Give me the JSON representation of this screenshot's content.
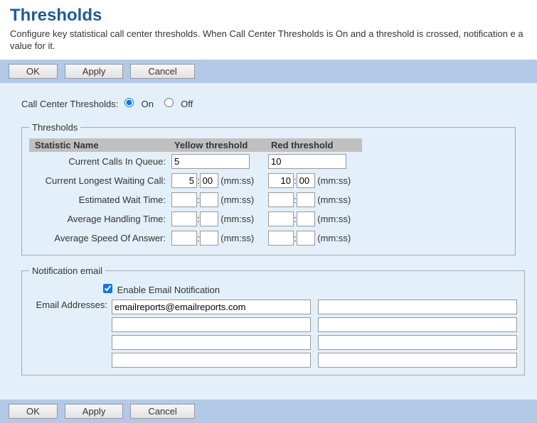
{
  "header": {
    "title": "Thresholds",
    "description": "Configure key statistical call center thresholds. When Call Center Thresholds is On and a threshold is crossed, notification e a value for it."
  },
  "buttons": {
    "ok": "OK",
    "apply": "Apply",
    "cancel": "Cancel"
  },
  "toggle": {
    "label": "Call Center Thresholds:",
    "on": "On",
    "off": "Off",
    "selected": "on"
  },
  "thresholds": {
    "legend": "Thresholds",
    "columns": {
      "stat": "Statistic Name",
      "yellow": "Yellow threshold",
      "red": "Red threshold"
    },
    "mmss": "(mm:ss)",
    "rows": {
      "current_calls": {
        "label": "Current Calls In Queue:",
        "yellow": "5",
        "red": "10",
        "is_time": false
      },
      "longest_waiting": {
        "label": "Current Longest Waiting Call:",
        "yellow_min": "5",
        "yellow_sec": "00",
        "red_min": "10",
        "red_sec": "00",
        "is_time": true
      },
      "estimated_wait": {
        "label": "Estimated Wait Time:",
        "yellow_min": "",
        "yellow_sec": "",
        "red_min": "",
        "red_sec": "",
        "is_time": true
      },
      "avg_handling": {
        "label": "Average Handling Time:",
        "yellow_min": "",
        "yellow_sec": "",
        "red_min": "",
        "red_sec": "",
        "is_time": true
      },
      "avg_speed": {
        "label": "Average Speed Of Answer:",
        "yellow_min": "",
        "yellow_sec": "",
        "red_min": "",
        "red_sec": "",
        "is_time": true
      }
    }
  },
  "notification": {
    "legend": "Notification email",
    "enable_label": "Enable Email Notification",
    "enabled": true,
    "addresses_label": "Email Addresses:",
    "emails": [
      "emailreports@emailreports.com",
      "",
      "",
      "",
      "",
      "",
      "",
      ""
    ]
  }
}
